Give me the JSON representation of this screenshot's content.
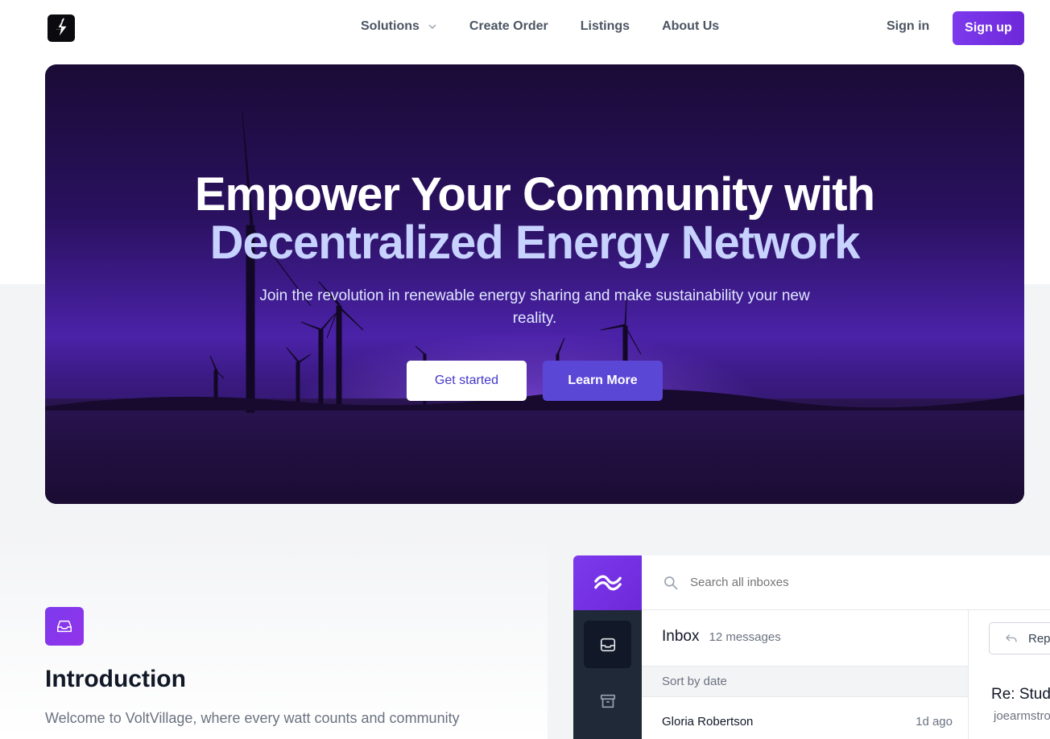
{
  "nav": {
    "items": [
      {
        "label": "Solutions",
        "has_dropdown": true
      },
      {
        "label": "Create Order"
      },
      {
        "label": "Listings"
      },
      {
        "label": "About Us"
      }
    ],
    "sign_in": "Sign in",
    "sign_up": "Sign up"
  },
  "hero": {
    "title_line1": "Empower Your Community with",
    "title_line2": "Decentralized Energy Network",
    "subtitle": "Join the revolution in renewable energy sharing and make sustainability your new reality.",
    "primary_cta": "Get started",
    "secondary_cta": "Learn More"
  },
  "intro": {
    "title": "Introduction",
    "text": "Welcome to VoltVillage, where every watt counts and community"
  },
  "app": {
    "search_placeholder": "Search all inboxes",
    "inbox_title": "Inbox",
    "inbox_count": "12 messages",
    "sort_label": "Sort by date",
    "messages": [
      {
        "from": "Gloria Robertson",
        "when": "1d ago"
      }
    ],
    "reply_label": "Rep",
    "detail_subject": "Re: Stud",
    "detail_from": "joearmstro"
  },
  "colors": {
    "accent": "#7c3aed",
    "hero_title_highlight": "#c7d2fe",
    "rail": "#1f2937"
  },
  "icons": {
    "logo": "lightning-bolt-icon",
    "solutions_dropdown": "chevron-down-icon",
    "intro": "inbox-tray-icon",
    "app_brand": "tailwind-waves-icon",
    "search": "search-icon",
    "inbox": "inbox-icon",
    "archive": "archive-icon",
    "reply": "reply-arrow-icon"
  }
}
